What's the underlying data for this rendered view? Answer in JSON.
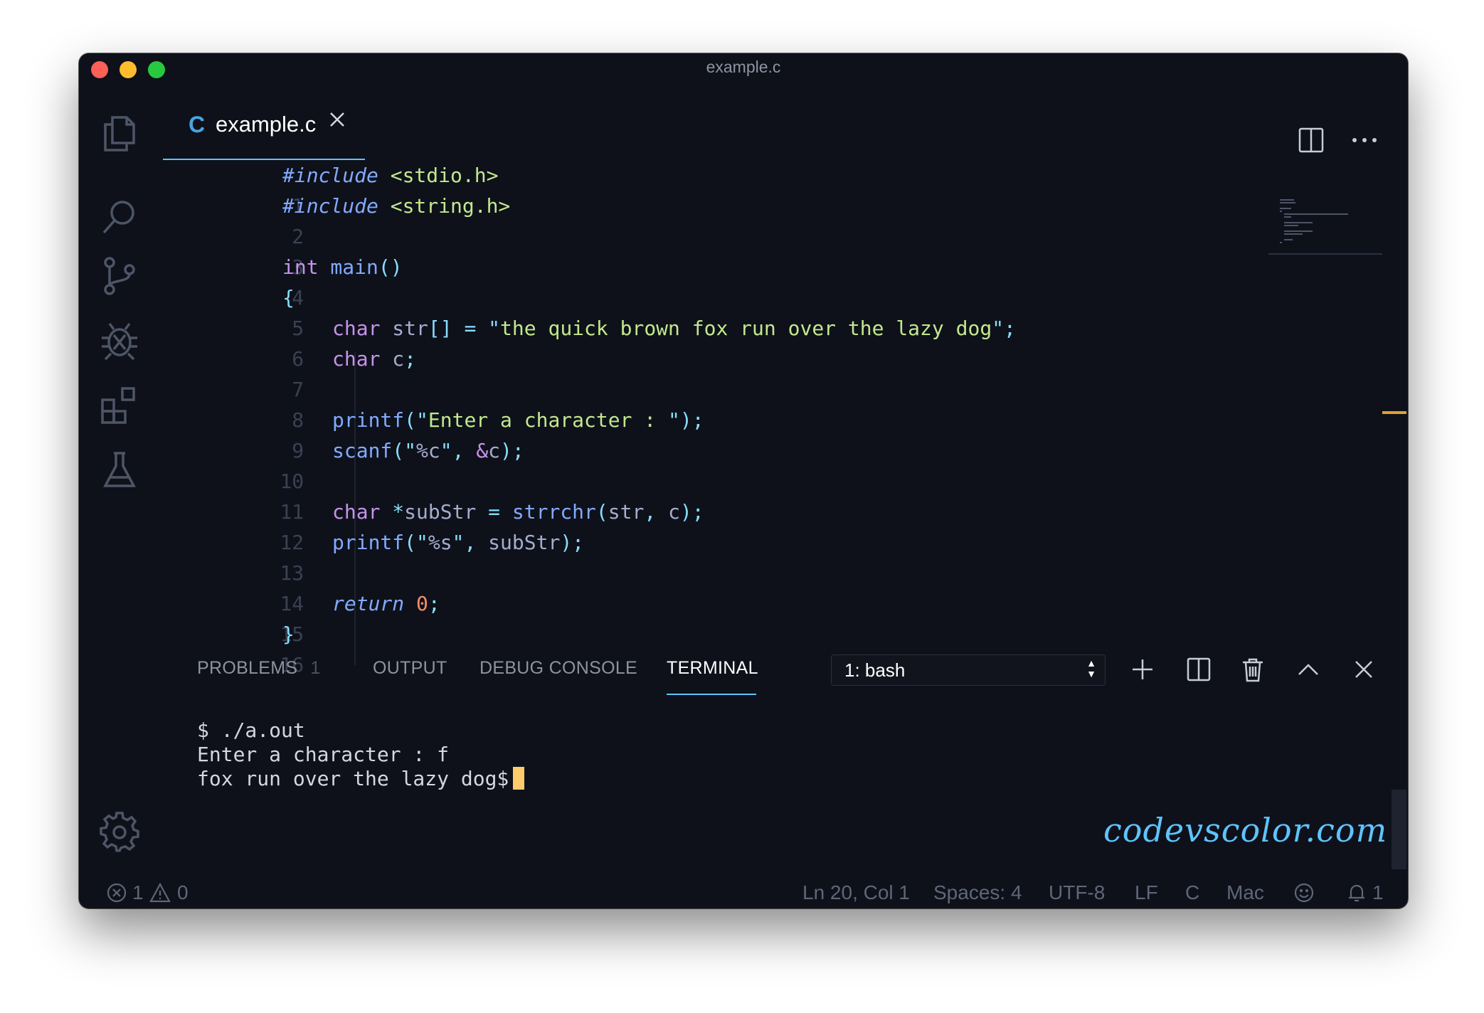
{
  "window": {
    "title": "example.c"
  },
  "tab": {
    "icon": "C",
    "label": "example.c"
  },
  "editor": {
    "lines": [
      {
        "n": "1"
      },
      {
        "n": "2"
      },
      {
        "n": "3"
      },
      {
        "n": "4"
      },
      {
        "n": "5"
      },
      {
        "n": "6"
      },
      {
        "n": "7"
      },
      {
        "n": "8"
      },
      {
        "n": "9"
      },
      {
        "n": "10"
      },
      {
        "n": "11"
      },
      {
        "n": "12"
      },
      {
        "n": "13"
      },
      {
        "n": "14"
      },
      {
        "n": "15"
      },
      {
        "n": "16"
      }
    ],
    "code": {
      "l1": {
        "a": "#include",
        "b": " <stdio.h>"
      },
      "l2": {
        "a": "#include",
        "b": " <string.h>"
      },
      "l4": {
        "a": "int",
        "b": " main",
        "c": "()"
      },
      "l5": {
        "a": "{"
      },
      "l6": {
        "a": "char",
        "b": " str",
        "c": "[]",
        "d": " = ",
        "e": "\"",
        "f": "the quick brown fox run over the lazy dog",
        "g": "\"",
        "h": ";"
      },
      "l7": {
        "a": "char",
        "b": " c",
        "c": ";"
      },
      "l9": {
        "a": "printf",
        "b": "(",
        "c": "\"",
        "d": "Enter a character : ",
        "e": "\"",
        "f": ");"
      },
      "l10": {
        "a": "scanf",
        "b": "(",
        "c": "\"",
        "d": "%c",
        "e": "\"",
        "f": ", ",
        "g": "&",
        "h": "c",
        "i": ");"
      },
      "l12": {
        "a": "char",
        "b": " *",
        "c": "subStr",
        "d": " = ",
        "e": "strrchr",
        "f": "(",
        "g": "str",
        "h": ", ",
        "i": "c",
        "j": ");"
      },
      "l13": {
        "a": "printf",
        "b": "(",
        "c": "\"",
        "d": "%s",
        "e": "\"",
        "f": ", ",
        "g": "subStr",
        "h": ");"
      },
      "l15": {
        "a": "return",
        "b": " ",
        "c": "0",
        "d": ";"
      },
      "l16": {
        "a": "}"
      }
    }
  },
  "panel": {
    "tabs": {
      "problems": "PROBLEMS",
      "problems_count": "1",
      "output": "OUTPUT",
      "debug": "DEBUG CONSOLE",
      "terminal": "TERMINAL"
    },
    "terminal_select": "1: bash"
  },
  "terminal": {
    "line1": "$ ./a.out",
    "line2": "Enter a character : f",
    "line3": "fox run over the lazy dog$"
  },
  "watermark": "codevscolor.com",
  "status": {
    "errors": "1",
    "warnings": "0",
    "position": "Ln 20, Col 1",
    "spaces": "Spaces: 4",
    "encoding": "UTF-8",
    "eol": "LF",
    "language": "C",
    "platform": "Mac",
    "notifications": "1"
  },
  "colors": {
    "accent": "#5ec4ff",
    "background": "#0e111a",
    "cursor": "#ffcb6b"
  },
  "icons": [
    "files-icon",
    "search-icon",
    "source-control-icon",
    "debug-icon",
    "extensions-icon",
    "flask-icon",
    "gear-icon",
    "split-editor-icon",
    "more-icon",
    "plus-icon",
    "split-terminal-icon",
    "trash-icon",
    "chevron-up-icon",
    "close-icon",
    "error-icon",
    "warning-icon",
    "smiley-icon",
    "bell-icon"
  ]
}
